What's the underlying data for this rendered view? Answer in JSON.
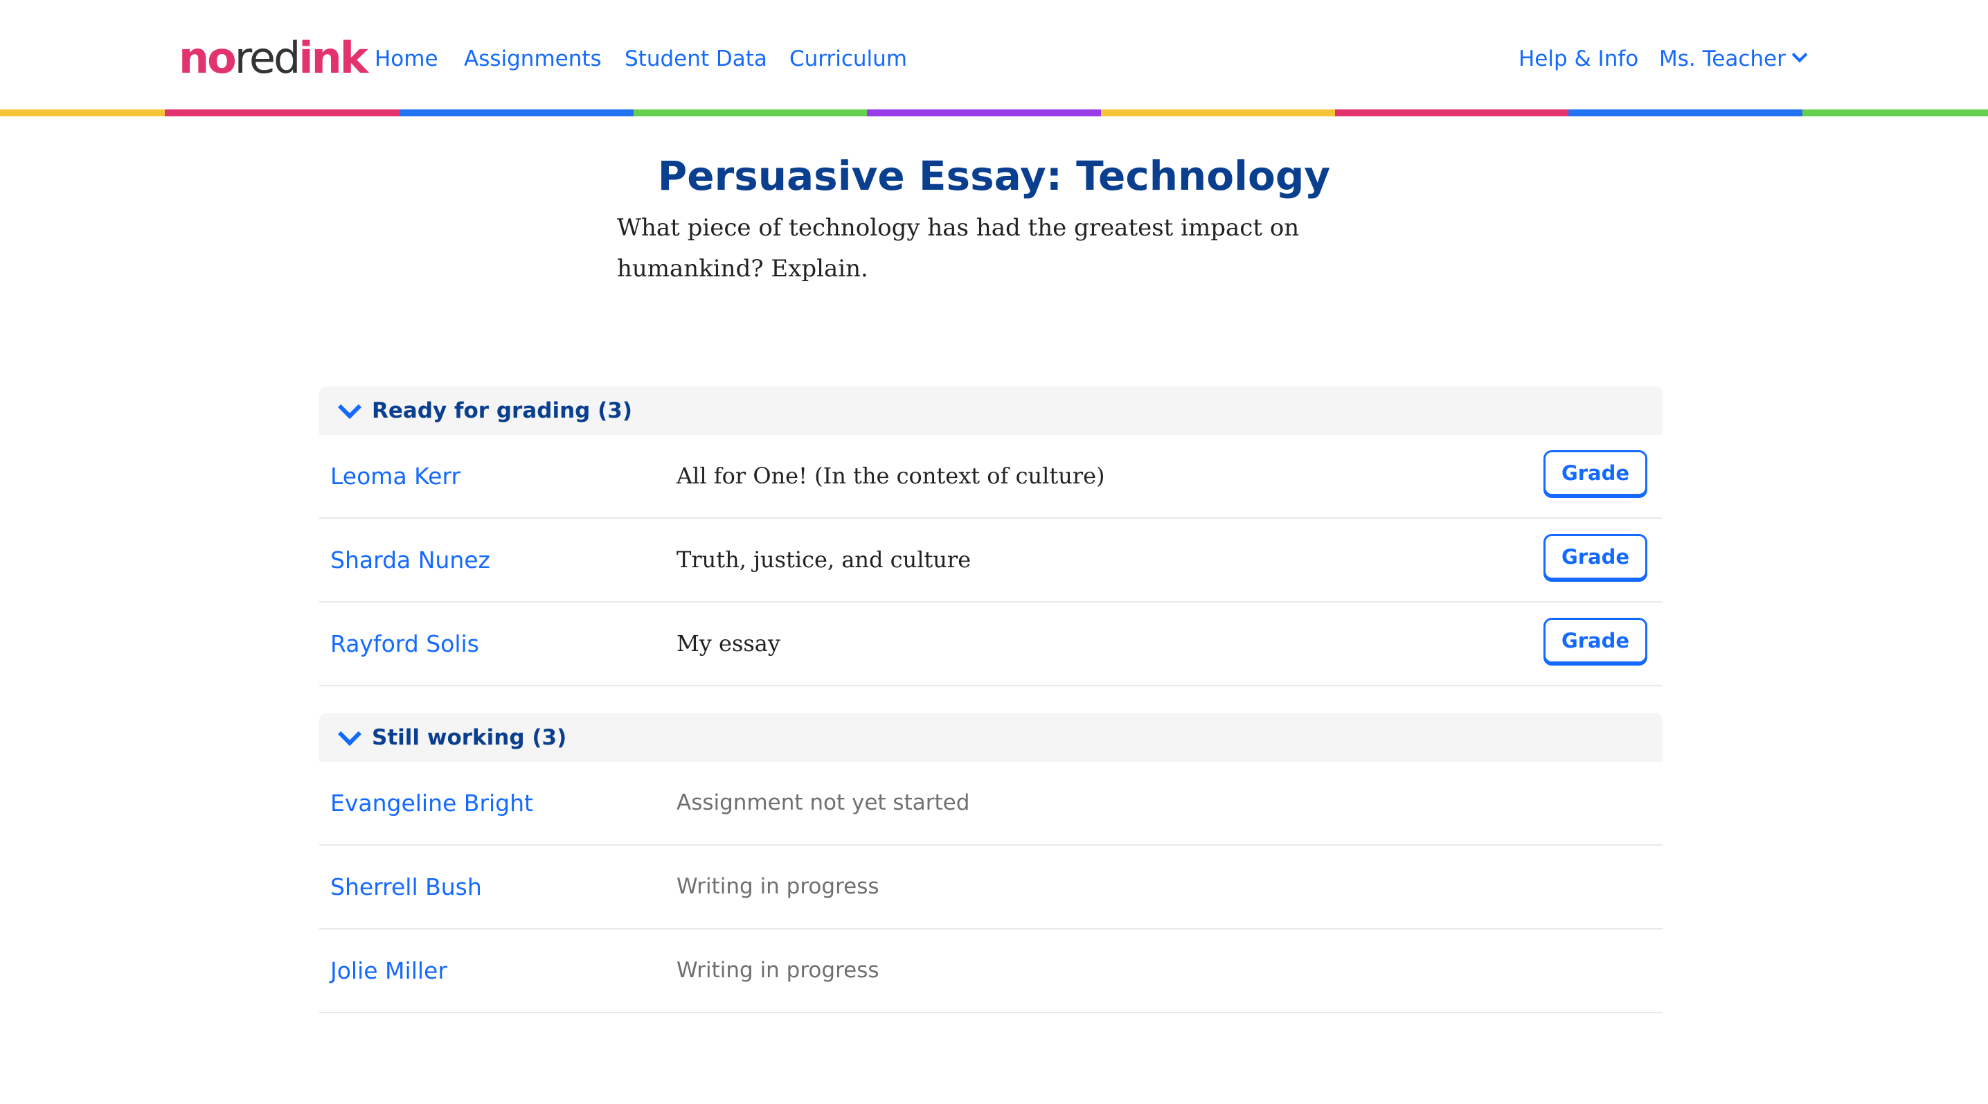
{
  "header": {
    "logo_no": "no",
    "logo_red": "red",
    "logo_ink": "ink",
    "nav": [
      {
        "label": "Home"
      },
      {
        "label": "Assignments"
      },
      {
        "label": "Student Data"
      },
      {
        "label": "Curriculum"
      }
    ],
    "help_label": "Help & Info",
    "user_label": "Ms. Teacher"
  },
  "rainbow_colors": [
    "#f8c437",
    "#e3336f",
    "#2273f3",
    "#65cf4f",
    "#983ce9",
    "#f8c437",
    "#e3336f",
    "#2273f3",
    "#65cf4f"
  ],
  "assignment": {
    "title": "Persuasive Essay: Technology",
    "prompt": "What piece of technology has had the greatest impact on humankind? Explain."
  },
  "sections": [
    {
      "label": "Ready for grading (3)",
      "rows": [
        {
          "name": "Leoma Kerr",
          "essay": "All for One! (In the context of culture)",
          "button": "Grade"
        },
        {
          "name": "Sharda Nunez",
          "essay": "Truth, justice, and culture",
          "button": "Grade"
        },
        {
          "name": "Rayford Solis",
          "essay": "My essay",
          "button": "Grade"
        }
      ]
    },
    {
      "label": "Still working (3)",
      "rows": [
        {
          "name": "Evangeline Bright",
          "status": "Assignment not yet started"
        },
        {
          "name": "Sherrell Bush",
          "status": "Writing in progress"
        },
        {
          "name": "Jolie Miller",
          "status": "Writing in progress"
        }
      ]
    }
  ],
  "colors": {
    "link": "#146aff",
    "title": "#0a3f8f",
    "brand_pink": "#e3336f"
  }
}
